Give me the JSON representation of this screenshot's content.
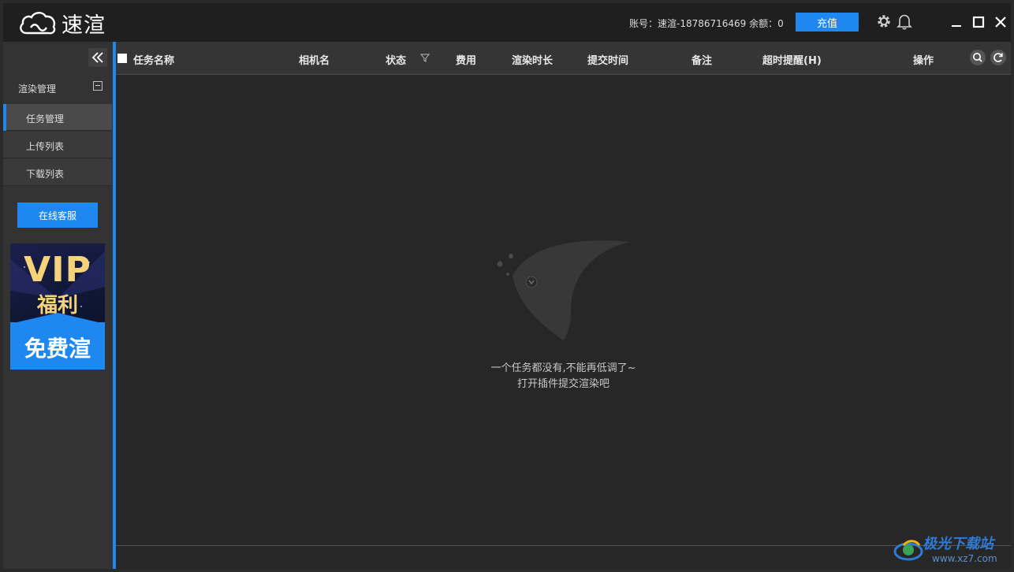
{
  "app": {
    "logo_text": "速渲",
    "account_text": "账号：速渲-18786716469  余额：0",
    "recharge_label": "充值"
  },
  "sidebar": {
    "group_label": "渲染管理",
    "items": [
      {
        "label": "任务管理",
        "active": true
      },
      {
        "label": "上传列表",
        "active": false
      },
      {
        "label": "下载列表",
        "active": false
      }
    ],
    "service_label": "在线客服",
    "vip": {
      "line1": "VIP",
      "line2": "福利",
      "line3": "免费渲"
    }
  },
  "table": {
    "columns": [
      "任务名称",
      "相机名",
      "状态",
      "费用",
      "渲染时长",
      "提交时间",
      "备注",
      "超时提醒(H)",
      "操作"
    ]
  },
  "empty": {
    "line1": "一个任务都没有,不能再低调了~",
    "line2": "打开插件提交渲染吧"
  },
  "watermark": {
    "title": "极光下载站",
    "url": "www.xz7.com"
  },
  "colors": {
    "accent": "#1e88f0",
    "titlebar": "#1f1f1f",
    "sidebar": "#333333",
    "content": "#272727"
  }
}
